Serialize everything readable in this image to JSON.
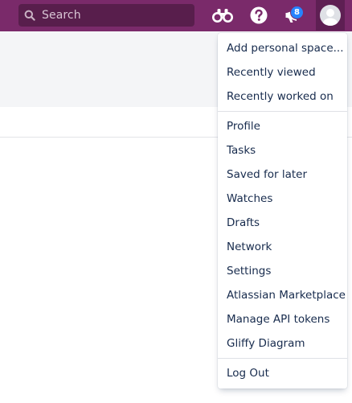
{
  "topbar": {
    "search_placeholder": "Search",
    "notification_count": "8",
    "colors": {
      "bar": "#7a2a6a",
      "badge": "#2684ff"
    },
    "icons": [
      "search-icon",
      "binoculars-icon",
      "help-icon",
      "notifications-icon",
      "avatar-icon"
    ]
  },
  "menu": {
    "section1": [
      "Add personal space...",
      "Recently viewed",
      "Recently worked on"
    ],
    "section2": [
      "Profile",
      "Tasks",
      "Saved for later",
      "Watches",
      "Drafts",
      "Network",
      "Settings",
      "Atlassian Marketplace",
      "Manage API tokens",
      "Gliffy Diagram"
    ],
    "section3": [
      "Log Out"
    ]
  }
}
